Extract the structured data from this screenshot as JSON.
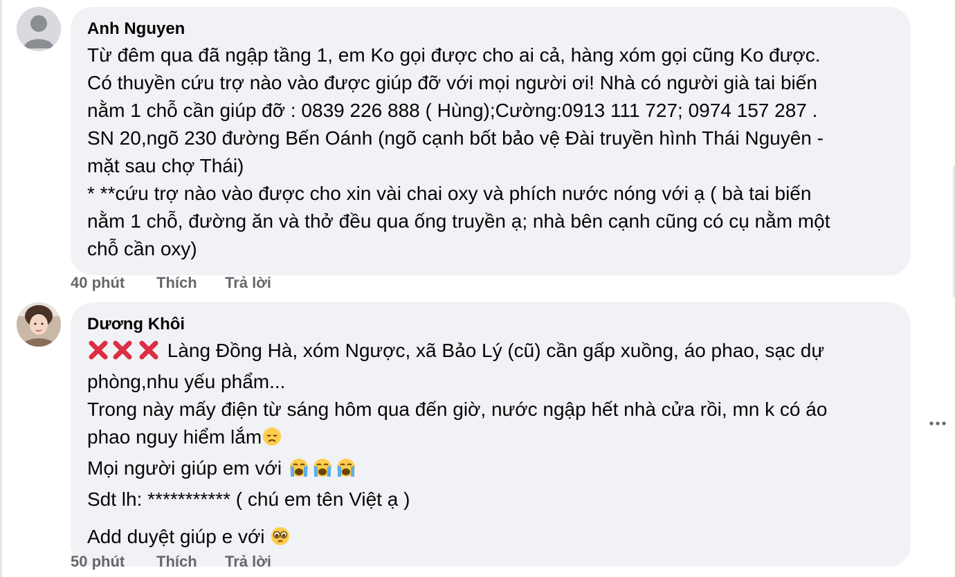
{
  "comments": [
    {
      "author": "Anh Nguyen",
      "lines": [
        "Từ đêm qua đã ngập tầng 1, em Ko gọi được cho ai cả, hàng xóm gọi cũng Ko được.",
        "Có thuyền cứu trợ nào vào được giúp đỡ với mọi người ơi! Nhà có người già tai biến",
        "nằm 1 chỗ cần giúp đỡ : 0839 226 888 ( Hùng);Cường:0913 111 727; 0974 157 287 .",
        "SN 20,ngõ 230 đường Bến Oánh (ngõ cạnh bốt bảo vệ Đài truyền hình Thái Nguyên -",
        "mặt sau chợ Thái)",
        "* **cứu trợ nào vào được cho xin vài chai oxy và phích nước nóng với ạ ( bà tai biến",
        "nằm 1 chỗ, đường ăn và thở đều qua ống truyền ạ; nhà bên cạnh cũng có cụ nằm một",
        "chỗ cần oxy)"
      ],
      "time": "40 phút",
      "like_label": "Thích",
      "reply_label": "Trả lời"
    },
    {
      "author": "Dương Khôi",
      "line1_text": " Làng Đồng Hà, xóm Ngược, xã Bảo Lý (cũ) cần gấp xuồng, áo phao, sạc dự",
      "line2": "phòng,nhu yếu phẩm...",
      "line3": "Trong này mấy điện từ sáng hôm qua đến giờ, nước ngập hết nhà cửa rồi, mn k có áo",
      "line4_text": "phao nguy hiểm lắm",
      "line5_text": "Mọi người giúp em với ",
      "line6": "Sdt lh: *********** ( chú em tên Việt ạ )",
      "line7_text": "Add duyệt giúp e với ",
      "time": "50 phút",
      "like_label": "Thích",
      "reply_label": "Trả lời",
      "icons": {
        "cross": "cross-mark-emoji",
        "sad": "disappointed-face-emoji",
        "cry": "loudly-crying-face-emoji",
        "plead": "pleading-face-emoji"
      }
    }
  ],
  "colors": {
    "bubble": "#f0f2f5",
    "text": "#050505",
    "meta": "#65676b",
    "cross": "#dd2e44",
    "emoji_yellow": "#ffcc4d"
  }
}
